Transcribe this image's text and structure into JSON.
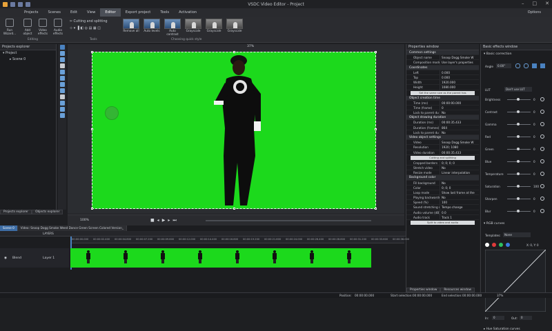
{
  "window": {
    "title": "VSDC Video Editor - Project"
  },
  "menu": {
    "items": [
      "Projects",
      "Scenes",
      "Edit",
      "View",
      "Editor",
      "Export project",
      "Tools",
      "Activation"
    ],
    "active": "Editor",
    "options": "Options"
  },
  "ribbon": {
    "buttons": [
      {
        "label": "Run Wizard..."
      },
      {
        "label": "Add object"
      },
      {
        "label": "Video effects"
      },
      {
        "label": "Audio effects"
      }
    ],
    "editing_label": "Editing",
    "tools_label": "Tools",
    "cutting": "Cutting and splitting",
    "styles_label": "Choosing quick style",
    "styles": [
      "Remove all",
      "Auto levels",
      "Auto contrast",
      "Grayscale",
      "Grayscale",
      "Grayscale"
    ]
  },
  "explorer": {
    "title": "Projects explorer",
    "tree": [
      "Project",
      "Scene 0"
    ],
    "tabs": [
      "Projects explorer",
      "Objects explorer"
    ]
  },
  "scene": {
    "zoom": "37%"
  },
  "timeline": {
    "tabs": [
      "Scene 0",
      "Video: Snoop Dogg Smoke Weed Dance Green Screen Colored Version_"
    ],
    "layers_label": "LAYERS",
    "track_blend": "Blend",
    "track_name": "Layer 1",
    "zoom": "100%",
    "ruler_ticks": [
      "00:00:00.000",
      "00:00:02.400",
      "00:00:04.800",
      "00:00:07.200",
      "00:00:09.600",
      "00:00:12.000",
      "00:00:14.400",
      "00:00:16.800",
      "00:00:19.200",
      "00:00:21.600",
      "00:00:24.000",
      "00:00:26.400",
      "00:00:28.800",
      "00:00:31.200",
      "00:00:33.600",
      "00:00:36.000"
    ]
  },
  "properties": {
    "title": "Properties window",
    "sections": [
      {
        "type": "sec",
        "label": "Common settings"
      },
      {
        "type": "row",
        "k": "Object name",
        "v": "Snoop Dogg Smoke W"
      },
      {
        "type": "row",
        "k": "Composition mode",
        "v": "Use layer's properties"
      },
      {
        "type": "sec",
        "label": "Coordinates"
      },
      {
        "type": "row",
        "k": "Left",
        "v": "0.000"
      },
      {
        "type": "row",
        "k": "Top",
        "v": "0.000"
      },
      {
        "type": "row",
        "k": "Width",
        "v": "1920.000"
      },
      {
        "type": "row",
        "k": "Height",
        "v": "1080.000"
      },
      {
        "type": "btn",
        "label": "Set the same size as the parent has"
      },
      {
        "type": "sec",
        "label": "Object creation time"
      },
      {
        "type": "row",
        "k": "Time (ms)",
        "v": "00:00:00.000"
      },
      {
        "type": "row",
        "k": "Time (frame)",
        "v": "0"
      },
      {
        "type": "row",
        "k": "Lock to parent du",
        "v": "No"
      },
      {
        "type": "sec",
        "label": "Object drawing duration"
      },
      {
        "type": "row",
        "k": "Duration (ms)",
        "v": "00:00:35.433"
      },
      {
        "type": "row",
        "k": "Duration (frames)",
        "v": "864"
      },
      {
        "type": "row",
        "k": "Lock to parent du",
        "v": "No"
      },
      {
        "type": "sec",
        "label": "Video object settings"
      },
      {
        "type": "row",
        "k": "Video",
        "v": "Snoop Dogg Smoke W"
      },
      {
        "type": "row",
        "k": "Resolution",
        "v": "1920; 1080"
      },
      {
        "type": "row",
        "k": "Video duration",
        "v": "00:00:35.433"
      },
      {
        "type": "btn",
        "label": "Cutting and splitting"
      },
      {
        "type": "row",
        "k": "Cropped borders",
        "v": "0; 0; 0; 0"
      },
      {
        "type": "row",
        "k": "Stretch video",
        "v": "No"
      },
      {
        "type": "row",
        "k": "Resize mode",
        "v": "Linear interpolation"
      },
      {
        "type": "sec",
        "label": "Background color"
      },
      {
        "type": "row",
        "k": "Fill background",
        "v": "No"
      },
      {
        "type": "row",
        "k": "Color",
        "v": "0; 0; 0"
      },
      {
        "type": "row",
        "k": "Loop mode",
        "v": "Show last frame at the"
      },
      {
        "type": "row",
        "k": "Playing backwards",
        "v": "No"
      },
      {
        "type": "row",
        "k": "Speed (%)",
        "v": "100"
      },
      {
        "type": "row",
        "k": "Sound stretching m",
        "v": "Tempo change"
      },
      {
        "type": "row",
        "k": "Audio volume (dB)",
        "v": "0.0"
      },
      {
        "type": "row",
        "k": "Audio track",
        "v": "Track 1"
      },
      {
        "type": "btn",
        "label": "Split to video and audio"
      }
    ],
    "tabs": [
      "Properties window",
      "Resources window"
    ]
  },
  "effects": {
    "title": "Basic effects window",
    "basic_label": "Basic correction",
    "angle_label": "Angle",
    "angle_value": "0.00°",
    "lut_label": "LUT",
    "lut_value": "Don't use LUT",
    "sliders": [
      {
        "k": "Brightness",
        "v": "0"
      },
      {
        "k": "Contrast",
        "v": "0"
      },
      {
        "k": "Gamma",
        "v": "0"
      },
      {
        "k": "Red",
        "v": "0"
      },
      {
        "k": "Green",
        "v": "0"
      },
      {
        "k": "Blue",
        "v": "0"
      },
      {
        "k": "Temperature",
        "v": "0"
      },
      {
        "k": "Saturation",
        "v": "100"
      },
      {
        "k": "Sharpen",
        "v": "0"
      },
      {
        "k": "Blur",
        "v": "0"
      }
    ],
    "rgb_label": "RGB curves",
    "templates_label": "Templates:",
    "templates_value": "None",
    "curve_xy": "X: 0, Y: 0",
    "in_label": "In:",
    "in_value": "0",
    "out_label": "Out:",
    "out_value": "0",
    "hue_label": "Hue Saturation curves"
  },
  "status": {
    "position_label": "Position:",
    "position": "00:00:00.000",
    "start_label": "Start selection:",
    "start": "00:00:00.000",
    "end_label": "End selection:",
    "end": "00:00:00.000",
    "zoom": "37%"
  },
  "colors": {
    "accent": "#3d6da5",
    "green_screen": "#1cd91c"
  }
}
